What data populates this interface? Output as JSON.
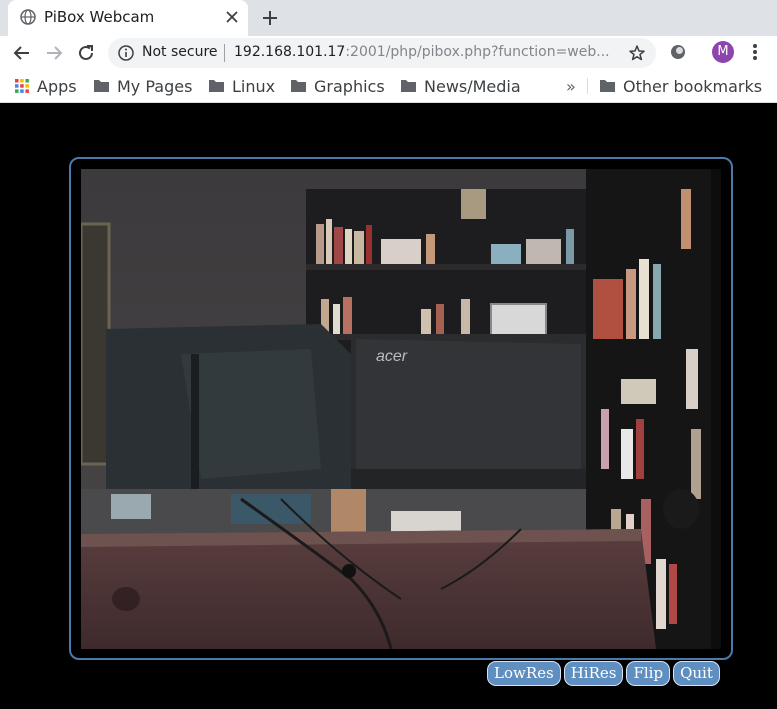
{
  "tab": {
    "title": "PiBox Webcam"
  },
  "omnibox": {
    "security_label": "Not secure",
    "url_host": "192.168.101.17",
    "url_path": ":2001/php/pibox.php?function=web..."
  },
  "profile": {
    "initial": "M",
    "color": "#8e44ad"
  },
  "bookmarks": {
    "items": [
      {
        "label": "Apps",
        "icon": "apps-grid-icon"
      },
      {
        "label": "My Pages",
        "icon": "folder-icon"
      },
      {
        "label": "Linux",
        "icon": "folder-icon"
      },
      {
        "label": "Graphics",
        "icon": "folder-icon"
      },
      {
        "label": "News/Media",
        "icon": "folder-icon"
      }
    ],
    "overflow": "»",
    "other": "Other bookmarks"
  },
  "controls": {
    "lowres": "LowRes",
    "hires": "HiRes",
    "flip": "Flip",
    "quit": "Quit"
  },
  "colors": {
    "frame_border": "#4b79a8",
    "button_bg": "#5e8fc0",
    "page_bg": "#000000"
  }
}
